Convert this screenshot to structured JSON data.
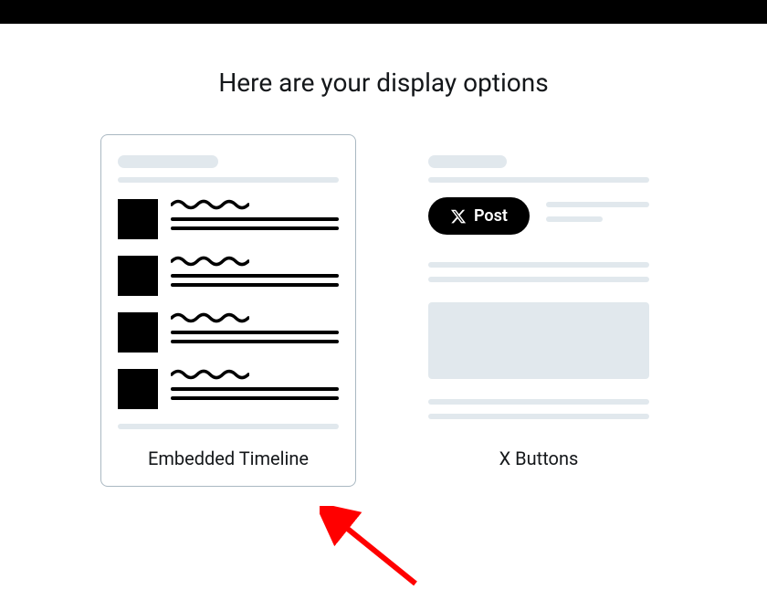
{
  "heading": "Here are your display options",
  "cards": {
    "timeline": {
      "label": "Embedded Timeline"
    },
    "xbuttons": {
      "label": "X Buttons",
      "postButton": "Post"
    }
  }
}
